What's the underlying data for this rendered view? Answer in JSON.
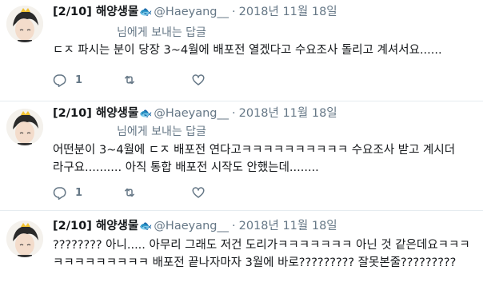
{
  "tweets": [
    {
      "name": "[2/10] 해양생물",
      "handle": "@Haeyang__",
      "dot": "·",
      "date": "2018년 11월 18일",
      "reply_to": "님에게 보내는 답글",
      "text_lines": [
        "ㄷㅈ 파시는 분이 당장 3~4월에 배포전 열겠다고 수요조사 돌리고 계셔서요......"
      ],
      "reply_count": "1"
    },
    {
      "name": "[2/10] 해양생물",
      "handle": "@Haeyang__",
      "dot": "·",
      "date": "2018년 11월 18일",
      "reply_to": "님에게 보내는 답글",
      "text_lines": [
        "어떤분이 3~4월에 ㄷㅈ 배포전 연다고ㅋㅋㅋㅋㅋㅋㅋㅋㅋㅋ 수요조사 받고 계시더",
        "라구요.......... 아직 통합 배포전 시작도 안했는데........"
      ],
      "reply_count": "1"
    },
    {
      "name": "[2/10] 해양생물",
      "handle": "@Haeyang__",
      "dot": "·",
      "date": "2018년 11월 18일",
      "text_lines": [
        "???????? 아니..... 아무리 그래도 저건 도리가ㅋㅋㅋㅋㅋㅋㅋ 아닌 것 같은데요ㅋㅋㅋ",
        "ㅋㅋㅋㅋㅋㅋㅋㅋㅋ 배포전 끝나자마자 3월에 바로????????? 잘못본줄?????????"
      ]
    }
  ],
  "colors": {
    "accent": "#1da1f2",
    "secondary_text": "#657786",
    "divider": "#e6ecf0"
  },
  "icons": {
    "verified_like": "fish-icon",
    "reply": "reply-icon",
    "retweet": "retweet-icon",
    "like": "heart-icon"
  }
}
